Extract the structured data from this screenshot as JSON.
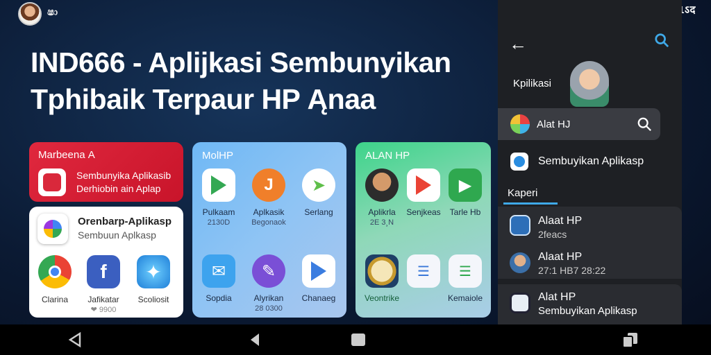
{
  "status_bar": {
    "left_text": "ෂා",
    "clock": "2020.1ऽद"
  },
  "headline": {
    "line1": "IND666 - Aplijkasi Sembunyikan",
    "line2": "Tphibaik Terpaur HP Ąnaa"
  },
  "red_card": {
    "title": "Marbeenа А",
    "line1": "Sembunyika Aplikasib",
    "line2": "Derhiobin ain Aplap"
  },
  "white_card": {
    "title": "Orenbarp-Aplikasp",
    "subtitle": "Sembuun Aplkasp",
    "apps": [
      {
        "label": "Clarina",
        "sub": ""
      },
      {
        "label": "Jafikatar",
        "sub": "❤ 9900"
      },
      {
        "label": "Scoliosit",
        "sub": ""
      }
    ]
  },
  "blue_card": {
    "title": "MolHP",
    "apps": [
      {
        "label": "Pulkaam",
        "sub": "2130D"
      },
      {
        "label": "Aplkasik",
        "sub": "Begonaok"
      },
      {
        "label": "Serlang",
        "sub": ""
      },
      {
        "label": "Sopdia",
        "sub": ""
      },
      {
        "label": "Alyrikan",
        "sub": "28 0300"
      },
      {
        "label": "Chanaeg",
        "sub": ""
      }
    ]
  },
  "green_card": {
    "title": "ALAN HP",
    "apps": [
      {
        "label": "Aplikrla",
        "sub": "2Е 3¸N"
      },
      {
        "label": "Senjkeas",
        "sub": ""
      },
      {
        "label": "Tarle Hb",
        "sub": ""
      },
      {
        "label": "Veontrike",
        "sub": ""
      },
      {
        "label": "Kemaiole",
        "sub": ""
      }
    ]
  },
  "panel": {
    "label": "Kpilikasi",
    "search_text": "Alat HJ",
    "plain_row": "Sembuyikan Aplikasp",
    "section": "Kaperi",
    "items": [
      {
        "title": "Alaat HP",
        "sub": "2feacs"
      },
      {
        "title": "Alaat HP",
        "sub": "27:1 HB7 28:22"
      },
      {
        "title": "Alat HP",
        "sub": "Sembuyikan Aplikasp"
      }
    ]
  },
  "colors": {
    "accent_blue": "#3fa9e8",
    "red": "#d9283b",
    "panel": "#1e2024"
  }
}
